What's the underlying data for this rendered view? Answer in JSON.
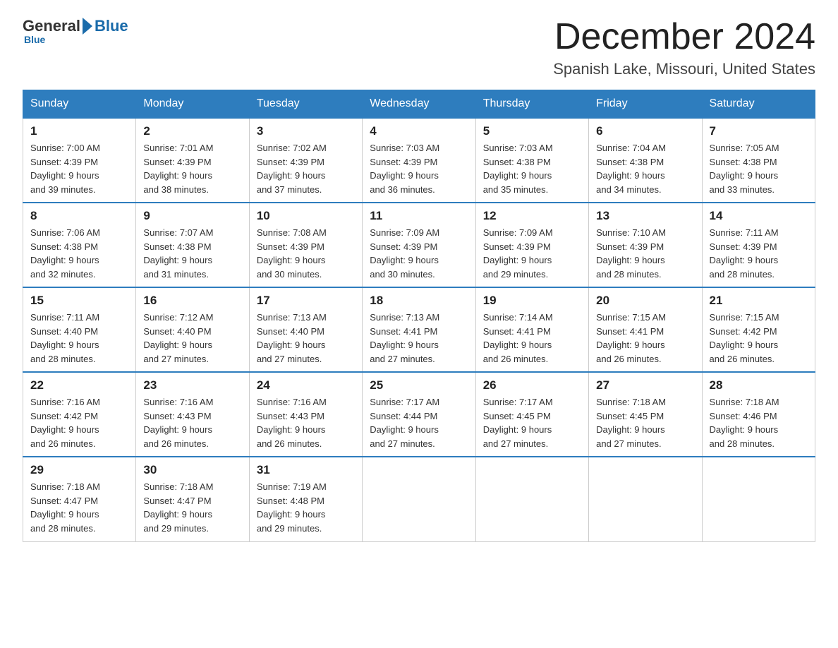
{
  "logo": {
    "general": "General",
    "blue": "Blue",
    "tagline": "Blue"
  },
  "header": {
    "month_year": "December 2024",
    "location": "Spanish Lake, Missouri, United States"
  },
  "weekdays": [
    "Sunday",
    "Monday",
    "Tuesday",
    "Wednesday",
    "Thursday",
    "Friday",
    "Saturday"
  ],
  "weeks": [
    [
      {
        "day": "1",
        "sunrise": "7:00 AM",
        "sunset": "4:39 PM",
        "daylight": "9 hours and 39 minutes."
      },
      {
        "day": "2",
        "sunrise": "7:01 AM",
        "sunset": "4:39 PM",
        "daylight": "9 hours and 38 minutes."
      },
      {
        "day": "3",
        "sunrise": "7:02 AM",
        "sunset": "4:39 PM",
        "daylight": "9 hours and 37 minutes."
      },
      {
        "day": "4",
        "sunrise": "7:03 AM",
        "sunset": "4:39 PM",
        "daylight": "9 hours and 36 minutes."
      },
      {
        "day": "5",
        "sunrise": "7:03 AM",
        "sunset": "4:38 PM",
        "daylight": "9 hours and 35 minutes."
      },
      {
        "day": "6",
        "sunrise": "7:04 AM",
        "sunset": "4:38 PM",
        "daylight": "9 hours and 34 minutes."
      },
      {
        "day": "7",
        "sunrise": "7:05 AM",
        "sunset": "4:38 PM",
        "daylight": "9 hours and 33 minutes."
      }
    ],
    [
      {
        "day": "8",
        "sunrise": "7:06 AM",
        "sunset": "4:38 PM",
        "daylight": "9 hours and 32 minutes."
      },
      {
        "day": "9",
        "sunrise": "7:07 AM",
        "sunset": "4:38 PM",
        "daylight": "9 hours and 31 minutes."
      },
      {
        "day": "10",
        "sunrise": "7:08 AM",
        "sunset": "4:39 PM",
        "daylight": "9 hours and 30 minutes."
      },
      {
        "day": "11",
        "sunrise": "7:09 AM",
        "sunset": "4:39 PM",
        "daylight": "9 hours and 30 minutes."
      },
      {
        "day": "12",
        "sunrise": "7:09 AM",
        "sunset": "4:39 PM",
        "daylight": "9 hours and 29 minutes."
      },
      {
        "day": "13",
        "sunrise": "7:10 AM",
        "sunset": "4:39 PM",
        "daylight": "9 hours and 28 minutes."
      },
      {
        "day": "14",
        "sunrise": "7:11 AM",
        "sunset": "4:39 PM",
        "daylight": "9 hours and 28 minutes."
      }
    ],
    [
      {
        "day": "15",
        "sunrise": "7:11 AM",
        "sunset": "4:40 PM",
        "daylight": "9 hours and 28 minutes."
      },
      {
        "day": "16",
        "sunrise": "7:12 AM",
        "sunset": "4:40 PM",
        "daylight": "9 hours and 27 minutes."
      },
      {
        "day": "17",
        "sunrise": "7:13 AM",
        "sunset": "4:40 PM",
        "daylight": "9 hours and 27 minutes."
      },
      {
        "day": "18",
        "sunrise": "7:13 AM",
        "sunset": "4:41 PM",
        "daylight": "9 hours and 27 minutes."
      },
      {
        "day": "19",
        "sunrise": "7:14 AM",
        "sunset": "4:41 PM",
        "daylight": "9 hours and 26 minutes."
      },
      {
        "day": "20",
        "sunrise": "7:15 AM",
        "sunset": "4:41 PM",
        "daylight": "9 hours and 26 minutes."
      },
      {
        "day": "21",
        "sunrise": "7:15 AM",
        "sunset": "4:42 PM",
        "daylight": "9 hours and 26 minutes."
      }
    ],
    [
      {
        "day": "22",
        "sunrise": "7:16 AM",
        "sunset": "4:42 PM",
        "daylight": "9 hours and 26 minutes."
      },
      {
        "day": "23",
        "sunrise": "7:16 AM",
        "sunset": "4:43 PM",
        "daylight": "9 hours and 26 minutes."
      },
      {
        "day": "24",
        "sunrise": "7:16 AM",
        "sunset": "4:43 PM",
        "daylight": "9 hours and 26 minutes."
      },
      {
        "day": "25",
        "sunrise": "7:17 AM",
        "sunset": "4:44 PM",
        "daylight": "9 hours and 27 minutes."
      },
      {
        "day": "26",
        "sunrise": "7:17 AM",
        "sunset": "4:45 PM",
        "daylight": "9 hours and 27 minutes."
      },
      {
        "day": "27",
        "sunrise": "7:18 AM",
        "sunset": "4:45 PM",
        "daylight": "9 hours and 27 minutes."
      },
      {
        "day": "28",
        "sunrise": "7:18 AM",
        "sunset": "4:46 PM",
        "daylight": "9 hours and 28 minutes."
      }
    ],
    [
      {
        "day": "29",
        "sunrise": "7:18 AM",
        "sunset": "4:47 PM",
        "daylight": "9 hours and 28 minutes."
      },
      {
        "day": "30",
        "sunrise": "7:18 AM",
        "sunset": "4:47 PM",
        "daylight": "9 hours and 29 minutes."
      },
      {
        "day": "31",
        "sunrise": "7:19 AM",
        "sunset": "4:48 PM",
        "daylight": "9 hours and 29 minutes."
      },
      null,
      null,
      null,
      null
    ]
  ],
  "labels": {
    "sunrise_prefix": "Sunrise: ",
    "sunset_prefix": "Sunset: ",
    "daylight_prefix": "Daylight: "
  }
}
